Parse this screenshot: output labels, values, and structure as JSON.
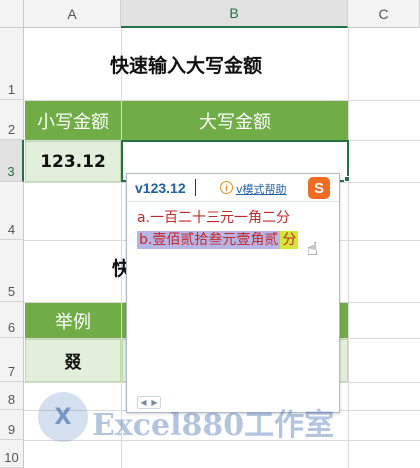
{
  "columns": [
    "A",
    "B",
    "C"
  ],
  "rows": [
    "1",
    "2",
    "3",
    "4",
    "5",
    "6",
    "7",
    "8",
    "9",
    "10"
  ],
  "sheet": {
    "title": "快速输入大写金额",
    "header_small": "小写金额",
    "header_big": "大写金额",
    "value_small": "123.12",
    "partial_title": "快",
    "example_header": "举例",
    "example_value": "叕"
  },
  "ime": {
    "input": "v123.12",
    "info_glyph": "i",
    "mode_help": "v模式帮助",
    "logo_letter": "S",
    "candidates": [
      {
        "index": "a.",
        "text": "一百二十三元一角二分"
      },
      {
        "index": "b.",
        "text": "壹佰贰拾叁元壹角贰",
        "text_end": "分"
      }
    ],
    "nav_prev": "◀",
    "nav_next": "▶"
  },
  "watermark": {
    "logo_text": "X",
    "text": "Excel880工作室"
  },
  "colors": {
    "header_green": "#70ad47",
    "cell_light_green": "#e2efda",
    "selection_green": "#217346",
    "candidate_red": "#c62828",
    "ime_blue": "#1f5fa8"
  }
}
